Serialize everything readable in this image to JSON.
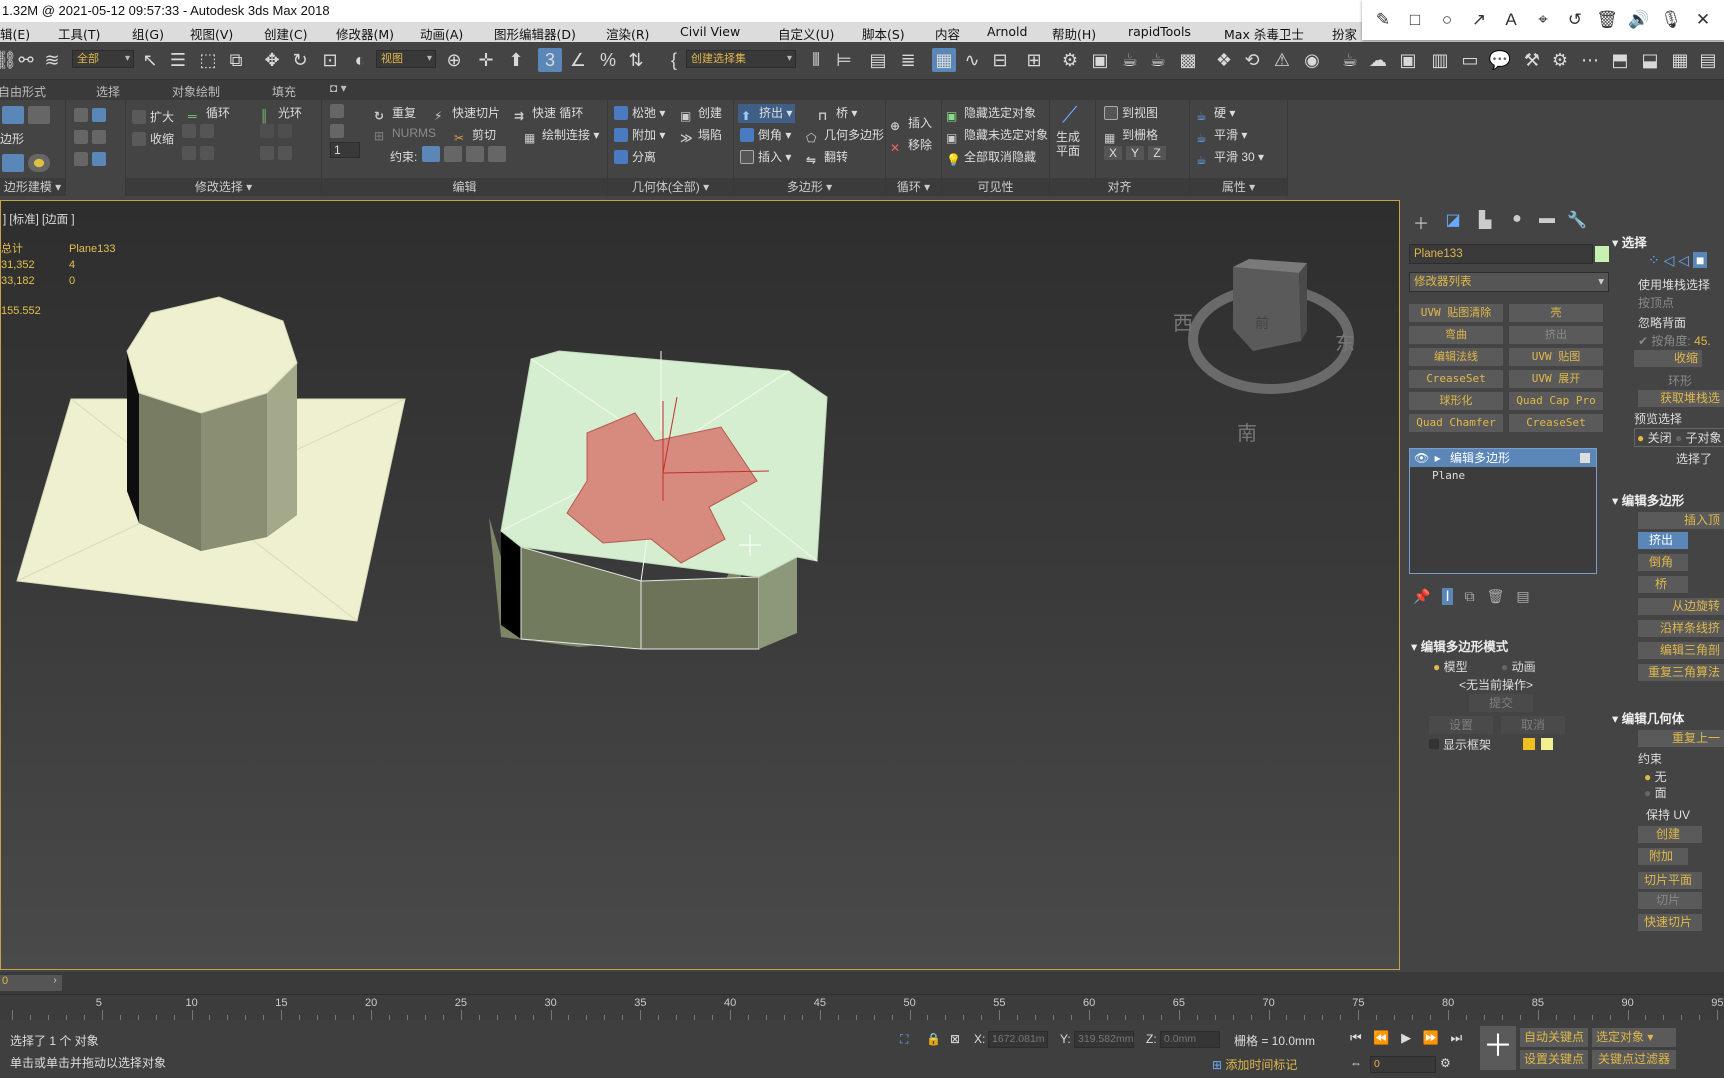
{
  "window": {
    "title": "1.32M @ 2021-05-12 09:57:33 - Autodesk 3ds Max 2018"
  },
  "annotation_toolbar": {
    "icons": [
      "pencil-icon",
      "rectangle-icon",
      "circle-icon",
      "arrow-icon",
      "text-icon",
      "highlighter-icon",
      "undo-icon",
      "delete-icon",
      "volume-icon",
      "mic-icon",
      "close-icon"
    ],
    "glyphs": [
      "✎",
      "□",
      "○",
      "↗",
      "A",
      "⌖",
      "↺",
      "🗑",
      "🔊",
      "🎙",
      "✕"
    ]
  },
  "menu": [
    "辑(E)",
    "工具(T)",
    "组(G)",
    "视图(V)",
    "创建(C)",
    "修改器(M)",
    "动画(A)",
    "图形编辑器(D)",
    "渲染(R)",
    "Civil View",
    "自定义(U)",
    "脚本(S)",
    "内容",
    "Arnold",
    "帮助(H)",
    "rapidTools",
    "Max 杀毒卫士",
    "扮家"
  ],
  "toolbar": {
    "filter": "全部",
    "refcoord": "视图",
    "selset": "创建选择集"
  },
  "ribbon_tabs": [
    "自由形式",
    "选择",
    "对象绘制",
    "填充"
  ],
  "ribbon": {
    "poly_modeling": {
      "label": "边形",
      "footer": "边形建模 ▾"
    },
    "modify_selection": {
      "grow": "扩大",
      "shrink": "收缩",
      "loop": "循环",
      "ring": "光环",
      "footer": "修改选择 ▾"
    },
    "edit": {
      "repeat": "重复",
      "quickslice": "快速切片",
      "quickloop": "快速 循环",
      "nurms": "NURMS",
      "cut": "剪切",
      "paintconnect": "绘制连接 ▾",
      "constraint": "约束:",
      "spinner": "1",
      "footer": "编辑"
    },
    "geometry": {
      "relax": "松弛 ▾",
      "create": "创建",
      "attach": "附加 ▾",
      "collapse": "塌陷",
      "detach": "分离",
      "footer": "几何体(全部) ▾"
    },
    "polygons": {
      "extrude": "挤出 ▾",
      "bevel": "倒角 ▾",
      "inset": "插入 ▾",
      "bridge": "桥 ▾",
      "geopoly": "几何多边形",
      "flip": "翻转",
      "footer": "多边形 ▾"
    },
    "loops": {
      "insert": "插入",
      "remove": "移除",
      "footer": "循环 ▾"
    },
    "visibility": {
      "hidesel": "隐藏选定对象",
      "hideunsel": "隐藏未选定对象",
      "unhide": "全部取消隐藏",
      "footer": "可见性"
    },
    "align": {
      "makeplanar": "生成\n平面",
      "toview": "到视图",
      "togrid": "到栅格",
      "x": "X",
      "y": "Y",
      "z": "Z",
      "footer": "对齐"
    },
    "properties": {
      "hard": "硬 ▾",
      "smooth": "平滑 ▾",
      "smooth30": "平滑 30 ▾",
      "footer": "属性 ▾"
    }
  },
  "viewport": {
    "label": "] [标准] [边面 ]",
    "stats": {
      "h1": "总计",
      "h2": "Plane133",
      "r1a": "31,352",
      "r1b": "4",
      "r2a": "33,182",
      "r2b": "0",
      "fps": "155.552"
    },
    "viewcube": {
      "west": "西",
      "east": "东",
      "south": "南",
      "face": "前"
    }
  },
  "cmdpanel": {
    "object_name": "Plane133",
    "object_color": "#c8f0b0",
    "modifier_list": "修改器列表",
    "mod_buttons": [
      [
        "UVW 贴图清除",
        "壳"
      ],
      [
        "弯曲",
        "挤出"
      ],
      [
        "编辑法线",
        "UVW 贴图"
      ],
      [
        "CreaseSet",
        "UVW 展开"
      ],
      [
        "球形化",
        "Quad Cap Pro"
      ],
      [
        "Quad Chamfer",
        "CreaseSet"
      ]
    ],
    "stack": [
      "编辑多边形",
      "Plane"
    ],
    "rollout_title": "编辑多边形模式",
    "model": "模型",
    "animate": "动画",
    "no_op": "<无当前操作>",
    "commit": "提交",
    "settings": "设置",
    "cancel": "取消",
    "show_cage": "显示框架"
  },
  "rpanel": {
    "selection_title": "选择",
    "use_stack": "使用堆栈选择",
    "by_vertex": "按顶点",
    "ignore_back": "忽略背面",
    "by_angle": "按角度:",
    "by_angle_val": "45.",
    "shrink": "收缩",
    "ring": "环形",
    "get_stack": "获取堆栈选",
    "preview": "预览选择",
    "off": "关闭",
    "subobj": "子对象",
    "selected": "选择了 ",
    "edit_poly_title": "编辑多边形",
    "insert_vertex": "插入顶",
    "extrude": "挤出",
    "bevel": "倒角",
    "bridge": "桥",
    "from_edge": "从边旋转",
    "along_spline": "沿样条线挤",
    "edit_tri": "编辑三角剖",
    "retri": "重复三角算法",
    "edit_geom_title": "编辑几何体",
    "repeat_last": "重复上一",
    "constraint": "约束",
    "none": "无",
    "face": "面",
    "keep_uv": "保持 UV",
    "create": "创建",
    "attach": "附加",
    "slice_plane": "切片平面",
    "slice": "切片",
    "quickslice": "快速切片"
  },
  "timeline": {
    "frame": "0",
    "ticks": [
      5,
      10,
      15,
      20,
      25,
      30,
      35,
      40,
      45,
      50,
      55,
      60,
      65,
      70,
      75,
      80,
      85,
      90,
      95
    ]
  },
  "status": {
    "selected": "选择了 1 个 对象",
    "hint": "单击或单击并拖动以选择对象",
    "x_label": "X:",
    "x_val": "1672.081m",
    "y_label": "Y:",
    "y_val": "319.582mm",
    "z_label": "Z:",
    "z_val": "0.0mm",
    "grid": "栅格 = 10.0mm",
    "add_time_tag": "添加时间标记",
    "autokey": "自动关键点",
    "setkey": "设置关键点",
    "selected_obj": "选定对象",
    "key_filter": "关键点过滤器",
    "frame_val": "0"
  }
}
